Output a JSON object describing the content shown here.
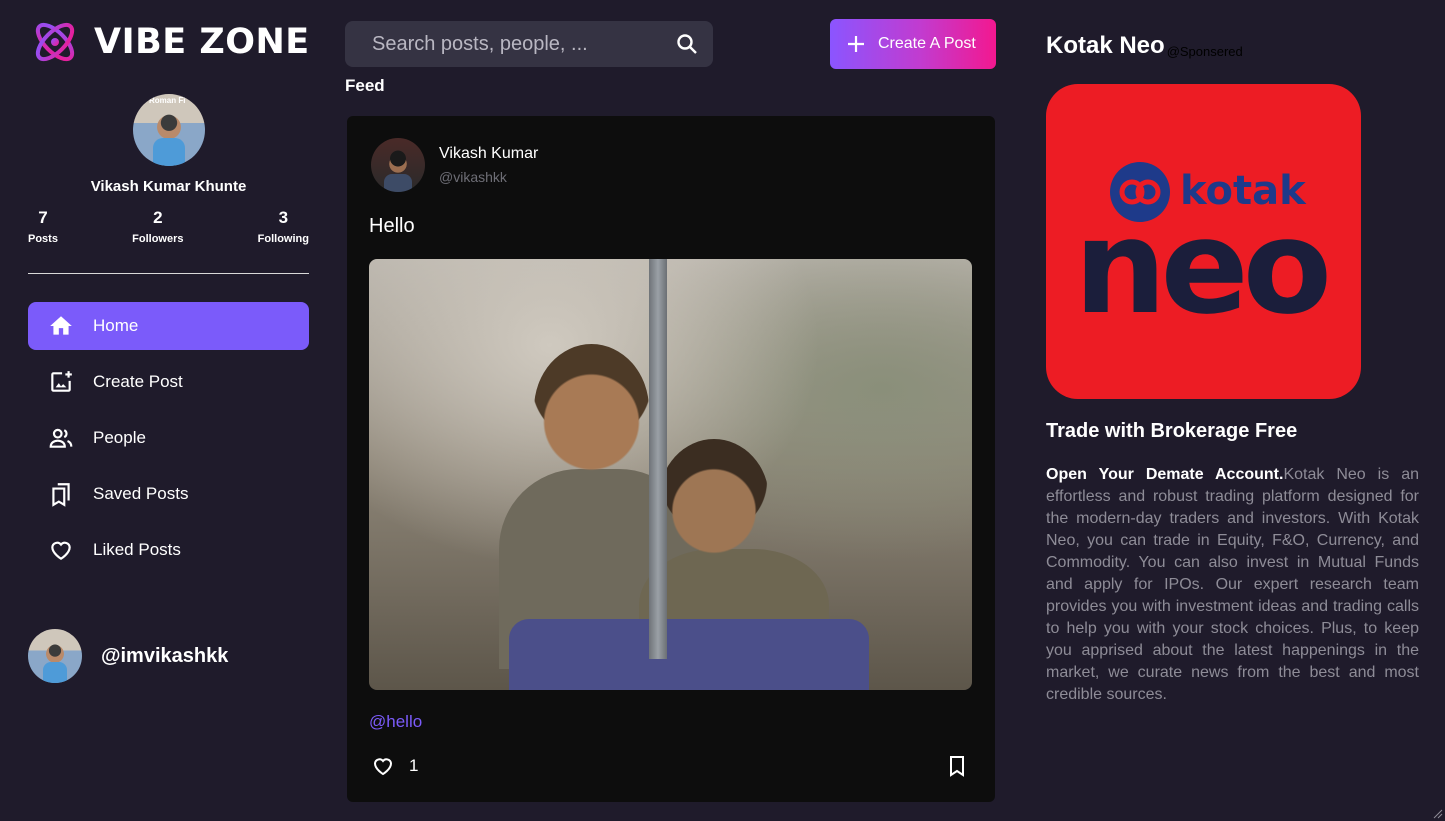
{
  "brand": {
    "name": "VIBE ZONE"
  },
  "profile": {
    "name": "Vikash Kumar Khunte",
    "avatar_tag": "Roman Fi",
    "stats": [
      {
        "value": "7",
        "label": "Posts"
      },
      {
        "value": "2",
        "label": "Followers"
      },
      {
        "value": "3",
        "label": "Following"
      }
    ]
  },
  "nav": {
    "items": [
      {
        "label": "Home",
        "icon": "home-icon",
        "active": true
      },
      {
        "label": "Create Post",
        "icon": "add-photo-icon"
      },
      {
        "label": "People",
        "icon": "people-icon"
      },
      {
        "label": "Saved Posts",
        "icon": "bookmarks-icon"
      },
      {
        "label": "Liked Posts",
        "icon": "heart-icon"
      }
    ]
  },
  "current_user": {
    "handle": "@imvikashkk"
  },
  "search": {
    "placeholder": "Search posts, people, ..."
  },
  "topbar": {
    "create_label": "Create A Post"
  },
  "feed": {
    "title": "Feed",
    "posts": [
      {
        "author": "Vikash Kumar",
        "handle": "@vikashkk",
        "text": "Hello",
        "tag": "@hello",
        "likes": "1"
      }
    ]
  },
  "ad": {
    "title": "Kotak Neo",
    "sponsored": "@Sponsered",
    "logo_top": "kotak",
    "logo_main": "neo",
    "headline": "Trade with Brokerage Free",
    "lead": "Open Your Demate Account.",
    "body": "Kotak Neo is an effortless and robust trading platform designed for the modern-day traders and investors. With Kotak Neo, you can trade in Equity, F&O, Currency, and Commodity. You can also invest in Mutual Funds and apply for IPOs. Our expert research team provides you with investment ideas and trading calls to help you with your stock choices. Plus, to keep you apprised about the latest happenings in the market, we curate news from the best and most credible sources."
  },
  "colors": {
    "background": "#1f1b2b",
    "accent": "#7b5bfa",
    "card": "#0d0d0d",
    "ad_red": "#ed1c24"
  }
}
